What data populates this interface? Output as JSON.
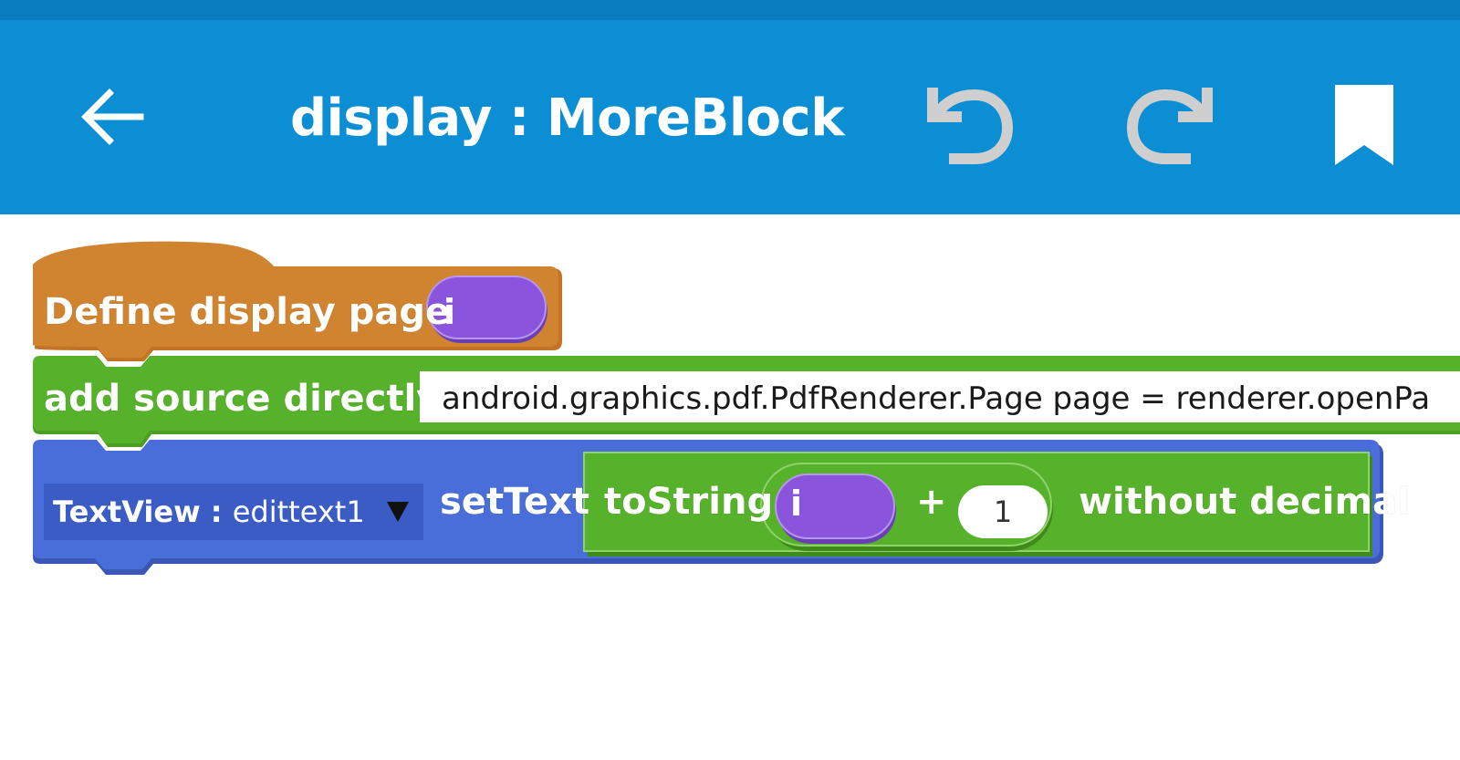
{
  "colors": {
    "app_bar": "#0b8ed4",
    "status_bar": "#0a7cc0",
    "define_block": "#d0842f",
    "add_source_block": "#57b22b",
    "settext_block": "#4a6ed9",
    "tostring_block": "#57b22b",
    "param_block": "#8a55dc"
  },
  "app_bar": {
    "title": "display : MoreBlock",
    "back_icon": "arrow-left-icon",
    "undo_icon": "undo-icon",
    "redo_icon": "redo-icon",
    "bookmark_icon": "bookmark-icon"
  },
  "blocks": {
    "define": {
      "label": "Define display page",
      "param": "i"
    },
    "add_source": {
      "label": "add source directly",
      "value": "android.graphics.pdf.PdfRenderer.Page page = renderer.openPa"
    },
    "set_text": {
      "view_prefix": "TextView : ",
      "view_name": "edittext1",
      "label": "setText",
      "to_string": {
        "label": "toString",
        "operand_param": "i",
        "operator": "+",
        "operand_value": "1",
        "suffix": "without decimal"
      }
    }
  }
}
